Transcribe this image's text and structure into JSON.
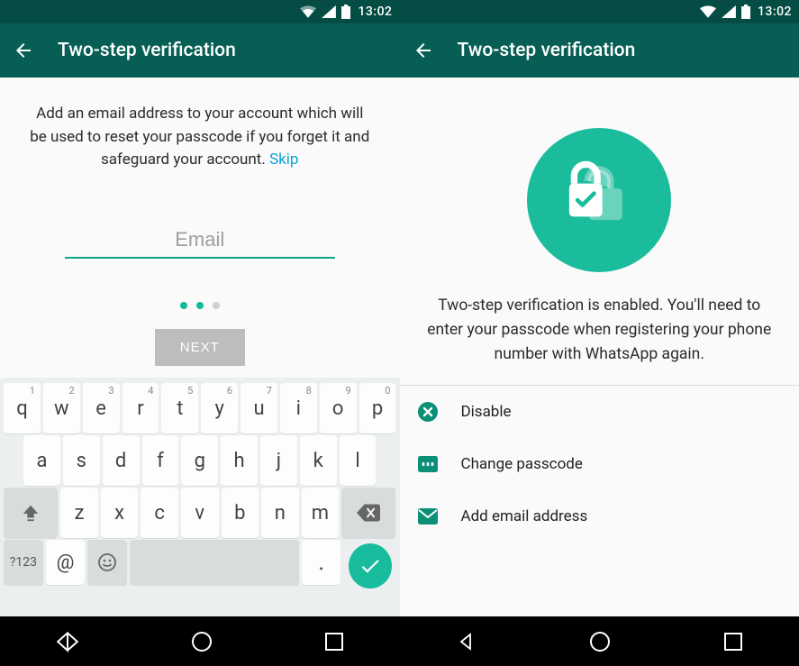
{
  "status": {
    "time": "13:02"
  },
  "appbar": {
    "title": "Two-step verification"
  },
  "left": {
    "lead_text": "Add an email address to your account which will be used to reset your passcode if you forget it and safeguard your account.",
    "skip_label": "Skip",
    "email_placeholder": "Email",
    "next_label": "NEXT",
    "keyboard": {
      "row1": [
        {
          "c": "q",
          "n": "1"
        },
        {
          "c": "w",
          "n": "2"
        },
        {
          "c": "e",
          "n": "3"
        },
        {
          "c": "r",
          "n": "4"
        },
        {
          "c": "t",
          "n": "5"
        },
        {
          "c": "y",
          "n": "6"
        },
        {
          "c": "u",
          "n": "7"
        },
        {
          "c": "i",
          "n": "8"
        },
        {
          "c": "o",
          "n": "9"
        },
        {
          "c": "p",
          "n": "0"
        }
      ],
      "row2": [
        "a",
        "s",
        "d",
        "f",
        "g",
        "h",
        "j",
        "k",
        "l"
      ],
      "row3": [
        "z",
        "x",
        "c",
        "v",
        "b",
        "n",
        "m"
      ],
      "sym_label": "?123",
      "at_label": "@",
      "period_label": "."
    }
  },
  "right": {
    "message": "Two-step verification is enabled. You'll need to enter your passcode when registering your phone number with WhatsApp again.",
    "options": {
      "disable_label": "Disable",
      "change_label": "Change passcode",
      "email_label": "Add email address"
    }
  }
}
